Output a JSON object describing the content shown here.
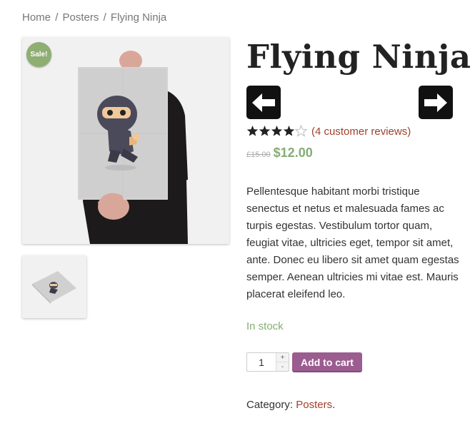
{
  "breadcrumb": {
    "home": "Home",
    "separator": "/",
    "category": "Posters",
    "current": "Flying Ninja"
  },
  "product": {
    "sale_badge": "Sale!",
    "title": "Flying Ninja",
    "rating": 4,
    "rating_max": 5,
    "reviews_link": "(4 customer reviews)",
    "old_price": "£15.00",
    "price": "$12.00",
    "description": "Pellentesque habitant morbi tristique senectus et netus et malesuada fames ac turpis egestas. Vestibulum tortor quam, feugiat vitae, ultricies eget, tempor sit amet, ante. Donec eu libero sit amet quam egestas semper. Aenean ultricies mi vitae est. Mauris placerat eleifend leo.",
    "stock": "In stock",
    "quantity": "1",
    "qty_plus": "+",
    "qty_minus": "-",
    "add_to_cart": "Add to cart",
    "category_label": "Category:",
    "category_value": "Posters",
    "category_end": "."
  },
  "icons": {
    "prev": "arrow-left-icon",
    "next": "arrow-right-icon",
    "star": "star-icon"
  },
  "colors": {
    "sale_badge": "#8fae72",
    "price": "#85ad74",
    "stock": "#85ad74",
    "link": "#a0402a",
    "button": "#9b5c8f",
    "nav_button": "#111111"
  }
}
